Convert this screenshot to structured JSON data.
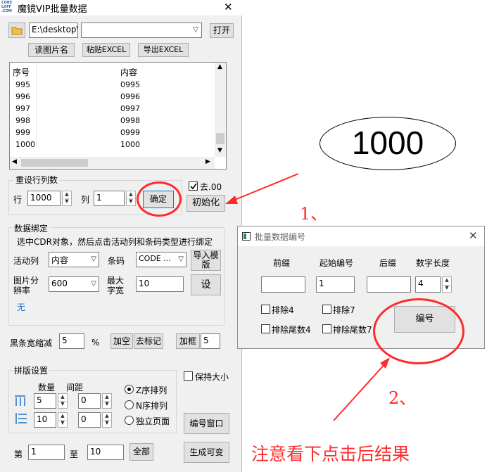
{
  "window": {
    "title": "魔镜VIP批量数据",
    "logo_text": "CORE LOFF .COM",
    "close_glyph": "✕"
  },
  "toolbar": {
    "folder_icon": "folder-open-icon",
    "path_value": "E:\\desktop\\",
    "combo_value": "",
    "open_label": "打开",
    "read_image_names_label": "读图片名",
    "paste_excel_label": "粘贴EXCEL",
    "export_excel_label": "导出EXCEL"
  },
  "table": {
    "headers": [
      "序号",
      "内容"
    ],
    "rows": [
      {
        "index": "995",
        "content": "0995"
      },
      {
        "index": "996",
        "content": "0996"
      },
      {
        "index": "997",
        "content": "0997"
      },
      {
        "index": "998",
        "content": "0998"
      },
      {
        "index": "999",
        "content": "0999"
      },
      {
        "index": "1000",
        "content": "1000"
      }
    ]
  },
  "reset": {
    "group_label": "重设行列数",
    "row_label": "行",
    "row_value": "1000",
    "col_label": "列",
    "col_value": "1",
    "confirm_label": "确定",
    "remove00_label": "去.00",
    "remove00_checked": true,
    "init_label": "初始化"
  },
  "binding": {
    "group_label": "数据绑定",
    "instruction": "选中CDR对象，然后点击活动列和条码类型进行绑定",
    "active_col_label": "活动列",
    "active_col_value": "内容",
    "barcode_label": "条码",
    "barcode_value": "CODE ...",
    "import_template_label": "导入模版",
    "resolution_label": "图片分辨率",
    "resolution_value": "600",
    "max_width_label": "最大字宽",
    "max_width_value": "10",
    "set_label": "设",
    "none_text": "无",
    "bar_shrink_label": "黑条宽缩减",
    "bar_shrink_value": "5",
    "percent": "%",
    "add_space_label": "加空",
    "remove_mark_label": "去标记",
    "add_frame_label": "加框",
    "frame_value": "5"
  },
  "layout": {
    "group_label": "拼版设置",
    "qty_label": "数量",
    "spacing_label": "间距",
    "qty1": "5",
    "space1": "0",
    "qty2": "10",
    "space2": "0",
    "keep_size_label": "保持大小",
    "z_order_label": "Z序排列",
    "n_order_label": "N序排列",
    "single_page_label": "独立页面",
    "numbering_window_label": "编号窗口"
  },
  "range": {
    "from_label": "第",
    "from_value": "1",
    "to_label": "至",
    "to_value": "10",
    "all_label": "全部",
    "generate_label": "生成可变"
  },
  "preview": {
    "number": "1000"
  },
  "dialog": {
    "title": "批量数据编号",
    "close_glyph": "✕",
    "prefix_label": "前缀",
    "start_label": "起始编号",
    "suffix_label": "后缀",
    "digits_label": "数字长度",
    "prefix_value": "",
    "start_value": "1",
    "suffix_value": "",
    "digits_value": "4",
    "exclude4_label": "排除4",
    "exclude7_label": "排除7",
    "exclude_tail4_label": "排除尾数4",
    "exclude_tail7_label": "排除尾数7",
    "number_button_label": "编号"
  },
  "annotations": {
    "step1": "1、",
    "step2": "2、",
    "note": "注意看下点击后结果",
    "color": "#ff2a2a"
  }
}
